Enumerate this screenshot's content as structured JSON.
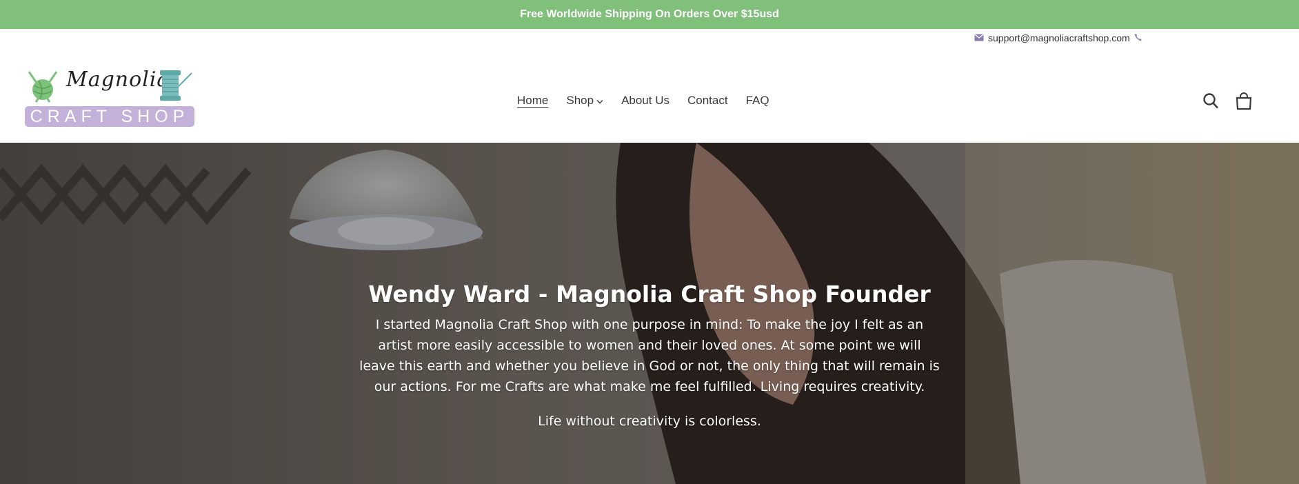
{
  "colors": {
    "announcement_bg": "#80c07b",
    "logo_band": "#c3b1da",
    "logo_green": "#7dc27b",
    "logo_teal": "#5fa8a8",
    "email_icon": "#8a7bb0"
  },
  "announcement": {
    "text": "Free Worldwide Shipping On Orders Over $15usd"
  },
  "contact": {
    "email": "support@magnoliacraftshop.com",
    "email_icon": "envelope-icon",
    "phone_icon": "phone-icon"
  },
  "logo": {
    "script": "Magnolia",
    "band": "CRAFT SHOP"
  },
  "nav": {
    "items": [
      {
        "label": "Home",
        "active": true
      },
      {
        "label": "Shop",
        "dropdown": true
      },
      {
        "label": "About Us"
      },
      {
        "label": "Contact"
      },
      {
        "label": "FAQ"
      }
    ]
  },
  "header_icons": [
    "search-icon",
    "cart-icon"
  ],
  "hero": {
    "title": "Wendy Ward - Magnolia Craft Shop Founder",
    "body": "I started Magnolia Craft Shop with one purpose in mind: To make the joy I felt as an artist more easily accessible to women and their loved ones. At some point we will leave this earth and whether you believe in God or not, the only thing that will remain is our actions. For me Crafts are what make me feel fulfilled. Living requires creativity.",
    "tagline": "Life without creativity is colorless."
  }
}
